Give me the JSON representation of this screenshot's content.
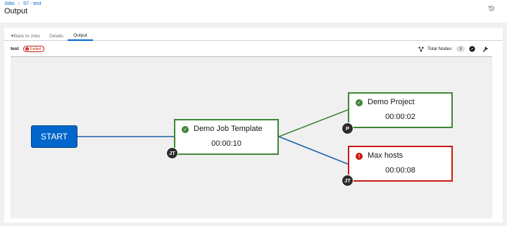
{
  "header": {
    "breadcrumb": {
      "jobs": "Jobs",
      "separator": "›",
      "current": "57 - test"
    },
    "title": "Output",
    "history_icon": "history-icon"
  },
  "tabs": [
    {
      "label": "Back to Jobs",
      "icon": "caret-left-icon"
    },
    {
      "label": "Details"
    },
    {
      "label": "Output",
      "active": true
    }
  ],
  "toolbar": {
    "job_name": "test",
    "status": "Failed",
    "status_icon": "exclamation-circle-icon",
    "total_nodes_label": "Total Nodes",
    "total_nodes_count": "3",
    "icons": [
      "topology-icon",
      "compass-icon",
      "wrench-icon"
    ]
  },
  "workflow": {
    "start_label": "START",
    "nodes": [
      {
        "name": "Demo Job Template",
        "time": "00:00:10",
        "status": "success",
        "type": "JT"
      },
      {
        "name": "Demo Project",
        "time": "00:00:02",
        "status": "success",
        "type": "P"
      },
      {
        "name": "Max hosts",
        "time": "00:00:08",
        "status": "failed",
        "type": "JT"
      }
    ],
    "link_colors": {
      "always": "#1a5ea8",
      "success": "#3e8635"
    }
  },
  "colors": {
    "primary": "#0066cc",
    "success": "#3e8635",
    "danger": "#c9190b"
  }
}
